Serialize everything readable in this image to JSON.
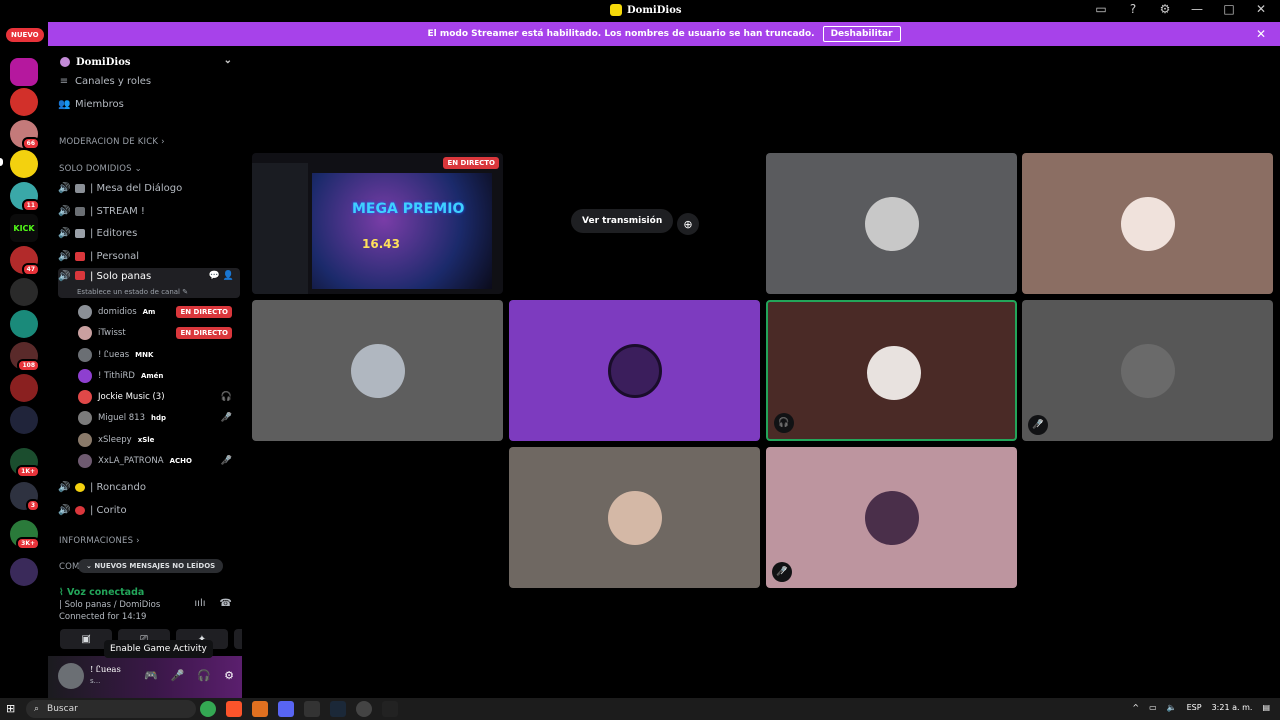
{
  "window": {
    "title": "DomiDios"
  },
  "banner": {
    "text": "El modo Streamer está habilitado. Los nombres de usuario se han truncado.",
    "button": "Deshabilitar"
  },
  "servers": {
    "nuevo": "NUEVO",
    "badges": [
      "66",
      "11",
      "47",
      "108",
      "1K+",
      "3",
      "3K+"
    ]
  },
  "guild": {
    "name": "DomiDios"
  },
  "channels": {
    "channels_roles": "Canales y roles",
    "members": "Miembros",
    "cat_kick": "MODERACION DE KICK",
    "cat_solo": "SOLO DOMIDIOS",
    "mesa": "| Mesa del Diálogo",
    "stream": "| STREAM !",
    "editores": "| Editores",
    "personal": "| Personal",
    "solo_panas": "| Solo panas",
    "status_hint": "Establece un estado de canal",
    "roncando": "| Roncando",
    "corito": "| Corito",
    "cat_info": "INFORMACIONES",
    "cat_com": "COM",
    "unread": "NUEVOS MENSAJES NO LEÍDOS"
  },
  "members": [
    {
      "name": "domidios",
      "tag": "Am",
      "live": "EN DIRECTO",
      "color": "#8a8f96"
    },
    {
      "name": "iTwisst",
      "tag": "",
      "live": "EN DIRECTO",
      "color": "#c9a0a0"
    },
    {
      "name": "! Ꮭueas",
      "tag": "MNK",
      "live": "",
      "color": "#6b6f74"
    },
    {
      "name": "! TithiRD",
      "tag": "Amén",
      "live": "",
      "color": "#8e3fd0"
    },
    {
      "name": "Jockie Music (3)",
      "tag": "",
      "live": "",
      "color": "#e04848"
    },
    {
      "name": "Miguel 813",
      "tag": "hdp",
      "live": "",
      "color": "#7b7b7b"
    },
    {
      "name": "xSleepy",
      "tag": "xSle",
      "live": "",
      "color": "#8a7a6a"
    },
    {
      "name": "XxLA_PATRONA",
      "tag": "ACHO",
      "live": "",
      "color": "#6e5a70"
    }
  ],
  "voice": {
    "connected": "Voz conectada",
    "channel": "| Solo panas / DomiDios",
    "duration": "Connected for 14:19",
    "tooltip": "Enable Game Activity"
  },
  "user": {
    "name": "! Ꮭueas",
    "status": "s..."
  },
  "stage": {
    "live_tag": "EN DIRECTO",
    "stream_title": "MEGA PREMIO",
    "stream_digits": "16.43",
    "watch": "Ver transmisión"
  },
  "tiles": [
    {
      "bg": "#5a5b5e",
      "avatar": "#c8c8c8"
    },
    {
      "bg": "#8b6e63",
      "avatar": "#f0e2dc"
    },
    {
      "bg": "#5e5e5e",
      "avatar": "#b0b7c0"
    },
    {
      "bg": "#7d3bbf",
      "avatar": "#3b1e5c"
    },
    {
      "bg": "#4a2a26",
      "avatar": "#e8e2df"
    },
    {
      "bg": "#575757",
      "avatar": "#6a6a6a"
    },
    {
      "bg": "#6f6862",
      "avatar": "#d4b8a6"
    },
    {
      "bg": "#bd959f",
      "avatar": "#4a2f4a"
    }
  ],
  "taskbar": {
    "search": "Buscar",
    "lang": "ESP",
    "time": "3:21 a. m."
  },
  "colors": {
    "accent": "#a742ea",
    "live": "#da373c",
    "connected": "#23a55a"
  }
}
